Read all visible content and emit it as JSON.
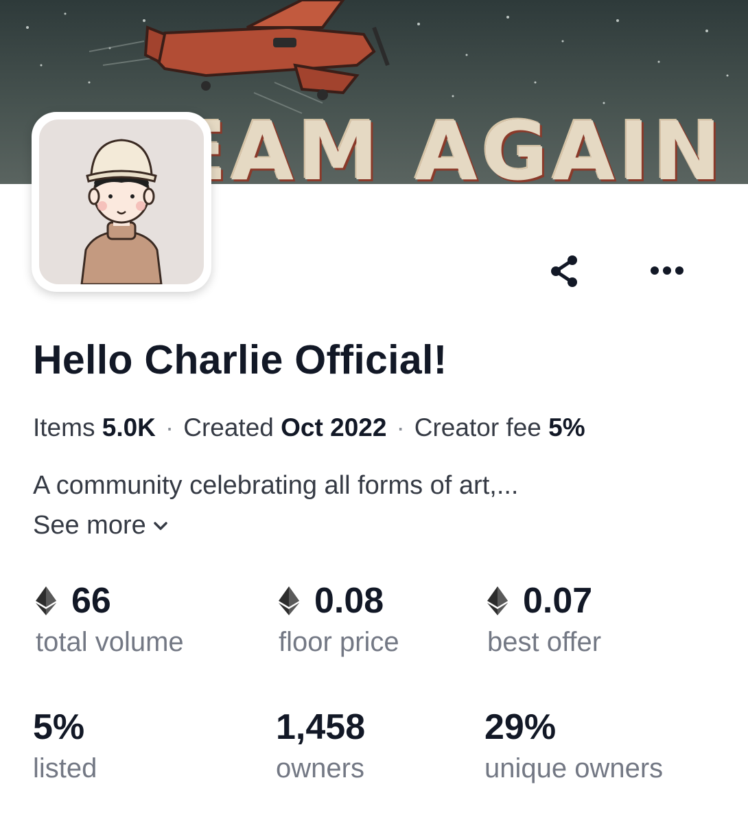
{
  "banner": {
    "text": "EAM AGAIN"
  },
  "collection": {
    "name": "Hello Charlie Official!",
    "items_label": "Items",
    "items_value": "5.0K",
    "created_label": "Created",
    "created_value": "Oct 2022",
    "fee_label": "Creator fee",
    "fee_value": "5%",
    "separator": "·",
    "description": "A community celebrating all forms of art,...",
    "see_more": "See more"
  },
  "actions": {
    "share_icon": "share-icon",
    "more_icon": "more-horizontal-icon"
  },
  "stats": {
    "total_volume": {
      "value": "66",
      "label": "total volume",
      "icon": "ethereum-icon"
    },
    "floor_price": {
      "value": "0.08",
      "label": "floor price",
      "icon": "ethereum-icon"
    },
    "best_offer": {
      "value": "0.07",
      "label": "best offer",
      "icon": "ethereum-icon"
    },
    "listed": {
      "value": "5%",
      "label": "listed"
    },
    "owners": {
      "value": "1,458",
      "label": "owners"
    },
    "unique_owners": {
      "value": "29%",
      "label": "unique owners"
    }
  }
}
